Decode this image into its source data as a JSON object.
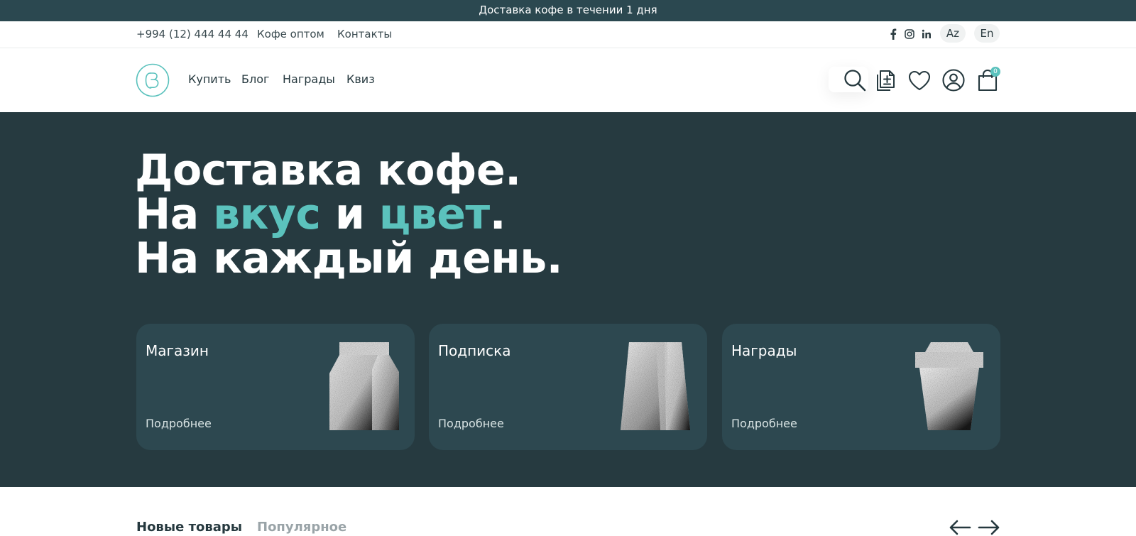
{
  "promo": {
    "text": "Доставка кофе в течении 1 дня"
  },
  "topbar": {
    "phone": "+994 (12) 444 44 44",
    "links": [
      "Кофе оптом",
      "Контакты"
    ],
    "social_icons": [
      "facebook-icon",
      "instagram-icon",
      "linkedin-icon"
    ],
    "languages": [
      "Az",
      "En"
    ]
  },
  "nav": {
    "items": [
      "Купить",
      "Блог",
      "Награды",
      "Квиз"
    ],
    "icons": [
      "search-icon",
      "order-list-icon",
      "heart-icon",
      "user-icon",
      "shopping-bag-icon"
    ],
    "cart_count": "0"
  },
  "hero": {
    "line1": "Доставка кофе.",
    "line2_a": "На ",
    "line2_accent1": "вкус",
    "line2_b": " и ",
    "line2_accent2": "цвет",
    "line2_c": ".",
    "line3": "На каждый день."
  },
  "cards": [
    {
      "title": "Магазин",
      "more": "Подробнее",
      "image": "coffee-bag-image"
    },
    {
      "title": "Подписка",
      "more": "Подробнее",
      "image": "paper-bag-image"
    },
    {
      "title": "Награды",
      "more": "Подробнее",
      "image": "coffee-cup-image"
    }
  ],
  "products": {
    "tabs": [
      "Новые товары",
      "Популярное"
    ],
    "arrows": [
      "arrow-left-icon",
      "arrow-right-icon"
    ]
  },
  "colors": {
    "accent": "#5bc2bd",
    "dark": "#263a40",
    "card": "#2d4850",
    "promo_bar": "#2b4850"
  }
}
